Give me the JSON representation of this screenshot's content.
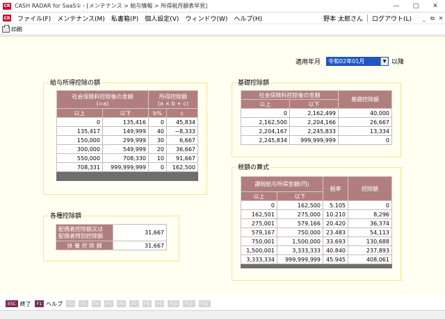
{
  "window": {
    "logo": "CR",
    "title": "CASH RADAR for SaaS① - [メンテナンス > 給与情報 > 所得税月額表早見]",
    "minimize": "—",
    "maximize": "□",
    "close": "✕"
  },
  "menubar": {
    "logo": "CR",
    "items": [
      "ファイル(F)",
      "メンテナンス(M)",
      "私書箱(P)",
      "個人設定(V)",
      "ウィンドウ(W)",
      "ヘルプ(H)"
    ],
    "user": "野本 太郎さん",
    "logout": "ログアウト(L)",
    "mdi_min": "_",
    "mdi_restore": "⧉",
    "mdi_close": "✕"
  },
  "toolbar": {
    "print": "印刷"
  },
  "period": {
    "label": "適用年月",
    "value": "令和02年01月",
    "suffix": "以降"
  },
  "salary_deduction": {
    "title": "給与所得控除の額",
    "h_group1": "社会保険料控除後の金額",
    "h_group1_sub": "(=a)",
    "h_group2": "所得控除額",
    "h_group2_sub": "(a × b + c)",
    "h_from": "以上",
    "h_to": "以下",
    "h_b": "b%",
    "h_c": "c",
    "rows": [
      [
        "0",
        "135,416",
        "0",
        "45,834"
      ],
      [
        "135,417",
        "149,999",
        "40",
        "−8,333"
      ],
      [
        "150,000",
        "299,999",
        "30",
        "6,667"
      ],
      [
        "300,000",
        "549,999",
        "20",
        "36,667"
      ],
      [
        "550,000",
        "708,330",
        "10",
        "91,667"
      ],
      [
        "708,331",
        "999,999,999",
        "0",
        "162,500"
      ]
    ]
  },
  "basic_deduction": {
    "title": "基礎控除額",
    "h_group": "社会保険料控除後の金額",
    "h_from": "以上",
    "h_to": "以下",
    "h_amount": "基礎控除額",
    "rows": [
      [
        "0",
        "2,162,499",
        "40,000"
      ],
      [
        "2,162,500",
        "2,204,166",
        "26,667"
      ],
      [
        "2,204,167",
        "2,245,833",
        "13,334"
      ],
      [
        "2,245,834",
        "999,999,999",
        "0"
      ]
    ]
  },
  "other_deduction": {
    "title": "各種控除額",
    "spouse_label_1": "配偶者控除額又は",
    "spouse_label_2": "配偶者特別控除額",
    "spouse_value": "31,667",
    "dependent_label": "扶 養 控 除 額",
    "dependent_value": "31,667"
  },
  "tax_formula": {
    "title": "税額の算式",
    "h_group": "課税給与所得金額(円)",
    "h_from": "以上",
    "h_to": "以下",
    "h_rate": "税率",
    "h_deduction": "控除額",
    "rows": [
      [
        "0",
        "162,500",
        "5.105",
        "0"
      ],
      [
        "162,501",
        "275,000",
        "10.210",
        "8,296"
      ],
      [
        "275,001",
        "579,166",
        "20.420",
        "36,374"
      ],
      [
        "579,167",
        "750,000",
        "23.483",
        "54,113"
      ],
      [
        "750,001",
        "1,500,000",
        "33.693",
        "130,688"
      ],
      [
        "1,500,001",
        "3,333,333",
        "40.840",
        "237,893"
      ],
      [
        "3,333,334",
        "999,999,999",
        "45.945",
        "408,061"
      ]
    ]
  },
  "fkeys": {
    "esc": "ESC",
    "esc_label": "終了",
    "f1": "F1",
    "f1_label": "ヘルプ",
    "f2": "F2",
    "f3": "F3",
    "f4": "F4",
    "f5": "F5",
    "f6": "F6",
    "f7": "F7",
    "f8": "F8",
    "f9": "F9",
    "f10": "F10",
    "f11": "F11",
    "f12": "F12"
  },
  "colors": {
    "header_bg": "#b07f7d",
    "frame_border": "#f3e784",
    "content_bg": "#fffff2",
    "select_bg": "#1f56c6",
    "brand_red": "#c8102e",
    "fkey_active": "#7a2b5a"
  }
}
